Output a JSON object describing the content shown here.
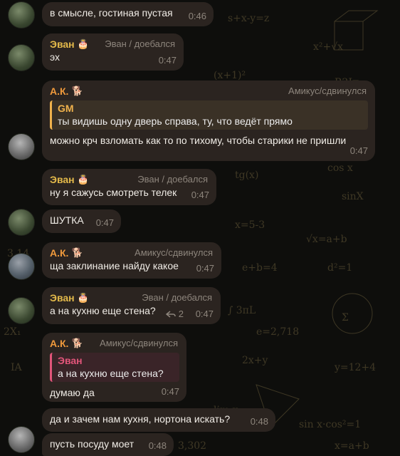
{
  "messages": [
    {
      "id": "m1",
      "text": "в смысле, гостиная пустая",
      "time": "0:46"
    },
    {
      "id": "m2",
      "sender": "Эван",
      "sender_emoji": "🎂",
      "role": "Эван / доебался",
      "text": "эх",
      "time": "0:47"
    },
    {
      "id": "m3",
      "sender": "А.К.",
      "sender_emoji": "🐕",
      "role": "Амикус/сдвинулся",
      "reply": {
        "name": "GM",
        "text": "ты видишь одну дверь справа, ту, что ведёт прямо"
      },
      "text": "можно крч взломать как то по тихому, чтобы старики не пришли",
      "time": "0:47"
    },
    {
      "id": "m4",
      "sender": "Эван",
      "sender_emoji": "🎂",
      "role": "Эван / доебался",
      "text": "ну я сажусь смотреть телек",
      "time": "0:47"
    },
    {
      "id": "m5",
      "text": "ШУТКА",
      "time": "0:47"
    },
    {
      "id": "m6",
      "sender": "А.К.",
      "sender_emoji": "🐕",
      "role": "Амикус/сдвинулся",
      "text": "ща заклинание найду какое",
      "time": "0:47"
    },
    {
      "id": "m7",
      "sender": "Эван",
      "sender_emoji": "🎂",
      "role": "Эван / доебался",
      "text": "а на кухню еще стена?",
      "time": "0:47",
      "reply_count": "2"
    },
    {
      "id": "m8",
      "sender": "А.К.",
      "sender_emoji": "🐕",
      "role": "Амикус/сдвинулся",
      "reply": {
        "name": "Эван",
        "text": "а на кухню еще стена?"
      },
      "text": "думаю да",
      "time": "0:47"
    },
    {
      "id": "m9",
      "text": "да и зачем нам кухня, нортона искать?",
      "time": "0:48"
    },
    {
      "id": "m10",
      "text": "пусть посуду моет",
      "time": "0:48"
    }
  ],
  "colors": {
    "bubble": "#2b2420",
    "evan": "#e3b94a",
    "ak": "#f09a3c",
    "gm_quote": "#f0b24c",
    "evan_quote": "#e2557a"
  },
  "icons": {
    "reply_count": "reply-arrow-icon"
  }
}
